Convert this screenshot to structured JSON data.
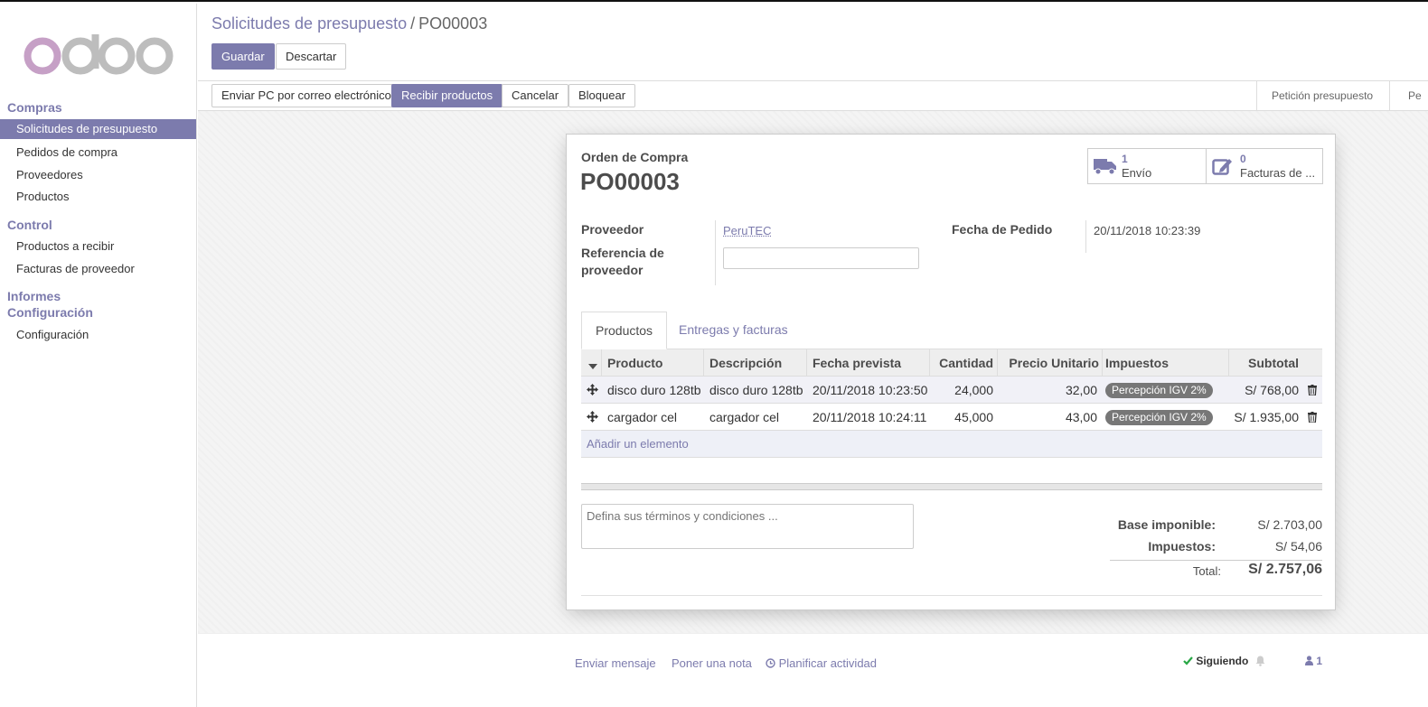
{
  "sidebar": {
    "sections": [
      {
        "title": "Compras",
        "items": [
          "Solicitudes de presupuesto",
          "Pedidos de compra",
          "Proveedores",
          "Productos"
        ]
      },
      {
        "title": "Control",
        "items": [
          "Productos a recibir",
          "Facturas de proveedor"
        ]
      },
      {
        "title": "Informes",
        "items": []
      },
      {
        "title": "Configuración",
        "items": [
          "Configuración"
        ]
      }
    ]
  },
  "breadcrumb": {
    "parent": "Solicitudes de presupuesto",
    "separator": "/",
    "current": "PO00003"
  },
  "actions": {
    "save": "Guardar",
    "discard": "Descartar"
  },
  "statusbar": {
    "buttons": [
      "Enviar PC por correo electrónico",
      "Recibir productos",
      "Cancelar",
      "Bloquear"
    ],
    "stages": [
      "Petición presupuesto",
      "Pe"
    ]
  },
  "form": {
    "type_label": "Orden de Compra",
    "name": "PO00003",
    "smart_buttons": [
      {
        "count": "1",
        "label": "Envío",
        "icon": "truck-icon"
      },
      {
        "count": "0",
        "label": "Facturas de ...",
        "icon": "pencil-square-icon"
      }
    ],
    "fields": {
      "vendor_label": "Proveedor",
      "vendor_value": "PeruTEC",
      "vendor_ref_label_1": "Referencia de",
      "vendor_ref_label_2": "proveedor",
      "vendor_ref_value": "",
      "date_label": "Fecha de Pedido",
      "date_value": "20/11/2018 10:23:39"
    },
    "tabs": [
      "Productos",
      "Entregas y facturas"
    ],
    "columns": [
      "Producto",
      "Descripción",
      "Fecha prevista",
      "Cantidad",
      "Precio Unitario",
      "Impuestos",
      "Subtotal"
    ],
    "lines": [
      {
        "product": "disco duro 128tb",
        "description": "disco duro 128tb",
        "date": "20/11/2018 10:23:50",
        "qty": "24,000",
        "price": "32,00",
        "tax": "Percepción IGV 2%",
        "subtotal": "S/ 768,00"
      },
      {
        "product": "cargador cel",
        "description": "cargador cel",
        "date": "20/11/2018 10:24:11",
        "qty": "45,000",
        "price": "43,00",
        "tax": "Percepción IGV 2%",
        "subtotal": "S/ 1.935,00"
      }
    ],
    "add_line": "Añadir un elemento",
    "notes_placeholder": "Defina sus términos y condiciones ...",
    "totals": {
      "untaxed_label": "Base imponible:",
      "untaxed_value": "S/ 2.703,00",
      "taxes_label": "Impuestos:",
      "taxes_value": "S/ 54,06",
      "total_label": "Total:",
      "total_value": "S/ 2.757,06"
    }
  },
  "chatter": {
    "send_message": "Enviar mensaje",
    "log_note": "Poner una nota",
    "schedule_activity": "Planificar actividad",
    "following": "Siguiendo",
    "followers_count": "1"
  },
  "colors": {
    "brand": "#7c7bad",
    "logo_o": "#c6a0c6",
    "logo_doo": "#bdbdbd"
  }
}
